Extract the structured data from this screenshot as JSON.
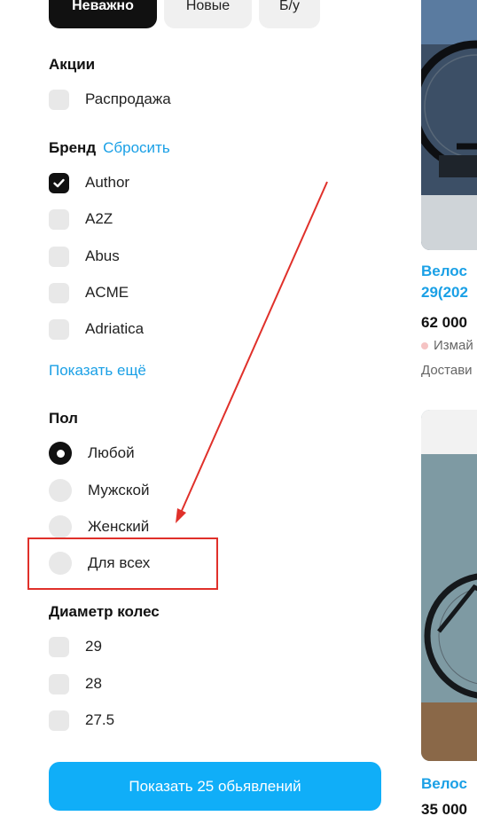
{
  "condition_tabs": [
    {
      "label": "Неважно",
      "active": true
    },
    {
      "label": "Новые",
      "active": false
    },
    {
      "label": "Б/у",
      "active": false
    }
  ],
  "promos": {
    "title": "Акции",
    "items": [
      {
        "label": "Распродажа",
        "checked": false
      }
    ]
  },
  "brand": {
    "title": "Бренд",
    "reset_label": "Сбросить",
    "items": [
      {
        "label": "Author",
        "checked": true
      },
      {
        "label": "A2Z",
        "checked": false
      },
      {
        "label": "Abus",
        "checked": false
      },
      {
        "label": "ACME",
        "checked": false
      },
      {
        "label": "Adriatica",
        "checked": false
      }
    ],
    "show_more_label": "Показать ещё"
  },
  "gender": {
    "title": "Пол",
    "items": [
      {
        "label": "Любой",
        "checked": true
      },
      {
        "label": "Мужской",
        "checked": false
      },
      {
        "label": "Женский",
        "checked": false
      },
      {
        "label": "Для всех",
        "checked": false
      }
    ]
  },
  "wheel_diameter": {
    "title": "Диаметр колес",
    "items": [
      {
        "label": "29",
        "checked": false
      },
      {
        "label": "28",
        "checked": false
      },
      {
        "label": "27.5",
        "checked": false
      }
    ]
  },
  "show_button_label": "Показать 25 обьявлений",
  "listings": [
    {
      "title_line1": "Велос",
      "title_line2": "29(202",
      "price": "62 000",
      "location": "Измай",
      "delivery": "Достави"
    },
    {
      "title_line1": "Велос",
      "price": "35 000"
    }
  ],
  "colors": {
    "accent": "#1aa0e6",
    "button": "#10aef8",
    "annotation": "#e0302a"
  }
}
